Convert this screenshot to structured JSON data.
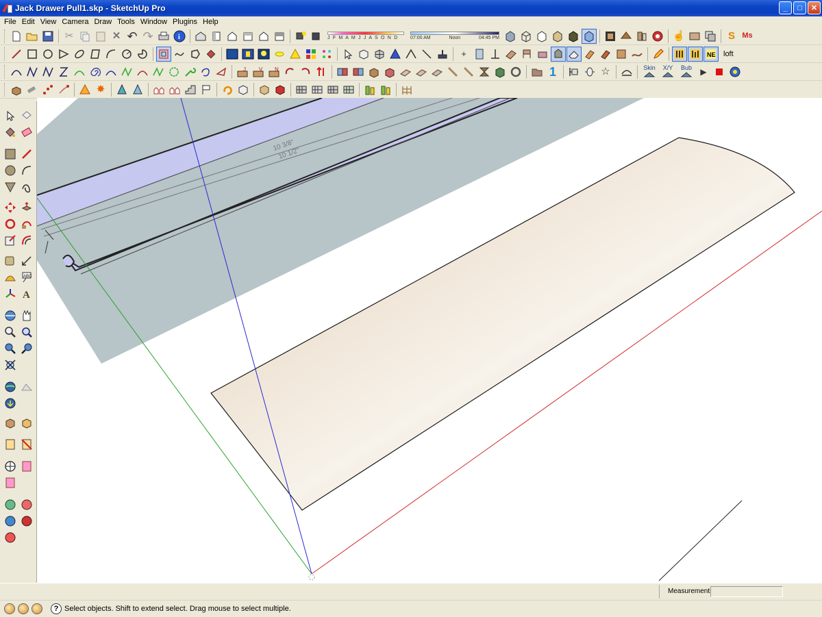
{
  "window": {
    "title": "Jack Drawer Pull1.skp - SketchUp Pro",
    "minimize": "_",
    "maximize": "□",
    "close": "✕"
  },
  "menu": [
    "File",
    "Edit",
    "View",
    "Camera",
    "Draw",
    "Tools",
    "Window",
    "Plugins",
    "Help"
  ],
  "shadow_settings": {
    "months": "J F M A M J J A S O N D",
    "time_start": "07:00 AM",
    "time_mid": "Noon",
    "time_end": "04:45 PM"
  },
  "plugin_labels": {
    "loft": "loft",
    "skin": "Skin",
    "xy": "X/Y",
    "bub": "Bub"
  },
  "viewport": {
    "dimension_1": "10 3/8\"",
    "dimension_2": "10 1/2\"",
    "colors": {
      "guide_plane": "#b7c4c8",
      "profile_fill": "#c6c8f0",
      "surface_light": "#f7f2ea",
      "surface_dark": "#e3cfb6",
      "red_axis": "#d2282a",
      "green_axis": "#2aa02a",
      "blue_axis": "#2a2ad0"
    }
  },
  "status": {
    "hint": "Select objects. Shift to extend select. Drag mouse to select multiple.",
    "measurements_label": "Measurements",
    "measurements_value": ""
  },
  "icons": {
    "row1": [
      "new-icon",
      "open-icon",
      "save-icon",
      "cut-icon",
      "copy-icon",
      "paste-icon",
      "erase-icon",
      "undo-icon",
      "redo-icon",
      "print-icon",
      "model-info-icon",
      "iso-view-icon",
      "top-view-icon",
      "front-view-icon",
      "right-view-icon",
      "back-view-icon",
      "left-view-icon",
      "shadows-icon",
      "fog-icon",
      "xray-icon",
      "wireframe-icon",
      "hidden-line-icon",
      "shaded-icon",
      "textured-icon",
      "monochrome-icon",
      "component-icon",
      "material-icon",
      "section-icon",
      "warehouse-icon",
      "hand-icon",
      "photo-icon",
      "sketchy-icon",
      "ruby-icon"
    ],
    "row2": [
      "line-icon",
      "rectangle-icon",
      "circle-icon",
      "polygon-icon",
      "arc-icon",
      "freehand-icon",
      "push-pull-icon",
      "offset-icon",
      "sandbox-icon",
      "smoove-icon",
      "stamp-icon",
      "drape-icon",
      "flip-edge-icon",
      "add-detail-icon"
    ],
    "row3": [
      "bezier-icon",
      "polyline-icon",
      "spiral-icon",
      "curve-icon",
      "weld-icon"
    ],
    "row4": [
      "extrude-icon",
      "round-corner-icon",
      "tools-on-surface-icon"
    ]
  }
}
